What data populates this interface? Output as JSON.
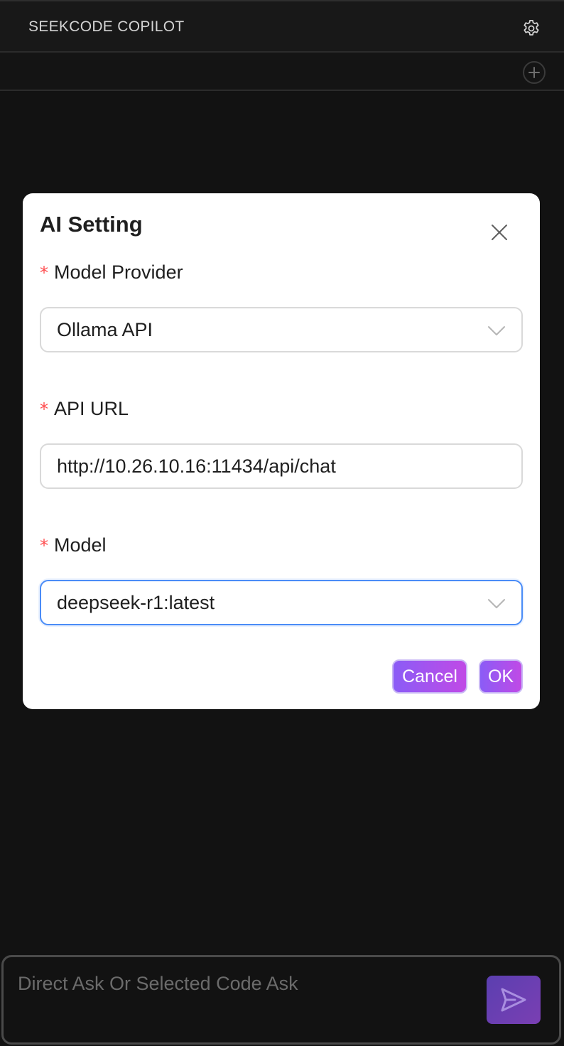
{
  "header": {
    "title": "SEEKCODE COPILOT"
  },
  "modal": {
    "title": "AI Setting",
    "required_mark": "*",
    "provider_label": "Model Provider",
    "provider_value": "Ollama API",
    "url_label": "API URL",
    "url_value": "http://10.26.10.16:11434/api/chat",
    "model_label": "Model",
    "model_value": "deepseek-r1:latest",
    "cancel_label": "Cancel",
    "ok_label": "OK"
  },
  "composer": {
    "placeholder": "Direct Ask Or Selected Code Ask"
  },
  "icons": {
    "settings": "gear-icon",
    "new_chat": "plus-circle-icon",
    "close": "close-icon",
    "dropdown": "chevron-down-icon",
    "send": "send-icon"
  },
  "colors": {
    "background": "#121212",
    "accent_start": "#8b5cf6",
    "accent_end": "#c04ae6",
    "required": "#ff4d4f",
    "focus_border": "#4a8cf7"
  }
}
